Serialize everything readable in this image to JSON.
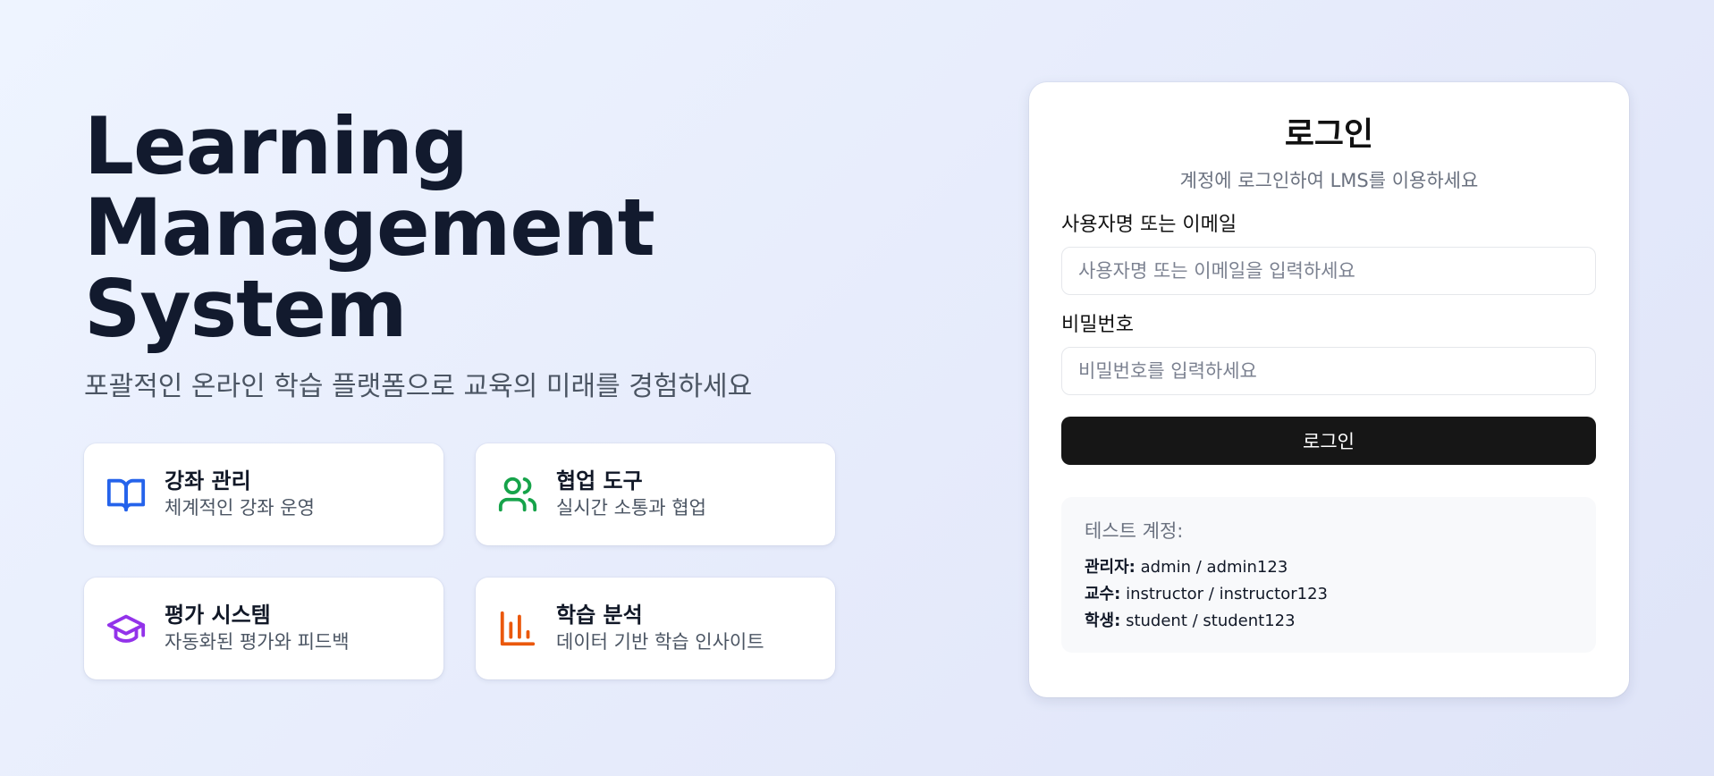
{
  "hero": {
    "title_lines": [
      "Learning",
      "Management",
      "System"
    ],
    "subtitle": "포괄적인 온라인 학습 플랫폼으로 교육의 미래를 경험하세요"
  },
  "features": [
    {
      "icon": "book-open-icon",
      "color": "#2563eb",
      "title": "강좌 관리",
      "desc": "체계적인 강좌 운영"
    },
    {
      "icon": "users-icon",
      "color": "#16a34a",
      "title": "협업 도구",
      "desc": "실시간 소통과 협업"
    },
    {
      "icon": "graduation-cap-icon",
      "color": "#9333ea",
      "title": "평가 시스템",
      "desc": "자동화된 평가와 피드백"
    },
    {
      "icon": "bar-chart-icon",
      "color": "#ea580c",
      "title": "학습 분석",
      "desc": "데이터 기반 학습 인사이트"
    }
  ],
  "login": {
    "title": "로그인",
    "subtitle": "계정에 로그인하여 LMS를 이용하세요",
    "username_label": "사용자명 또는 이메일",
    "username_placeholder": "사용자명 또는 이메일을 입력하세요",
    "username_value": "",
    "password_label": "비밀번호",
    "password_placeholder": "비밀번호를 입력하세요",
    "password_value": "",
    "button_label": "로그인"
  },
  "test_accounts": {
    "title": "테스트 계정:",
    "rows": [
      {
        "role": "관리자:",
        "creds": "admin / admin123"
      },
      {
        "role": "교수:",
        "creds": "instructor / instructor123"
      },
      {
        "role": "학생:",
        "creds": "student / student123"
      }
    ]
  }
}
